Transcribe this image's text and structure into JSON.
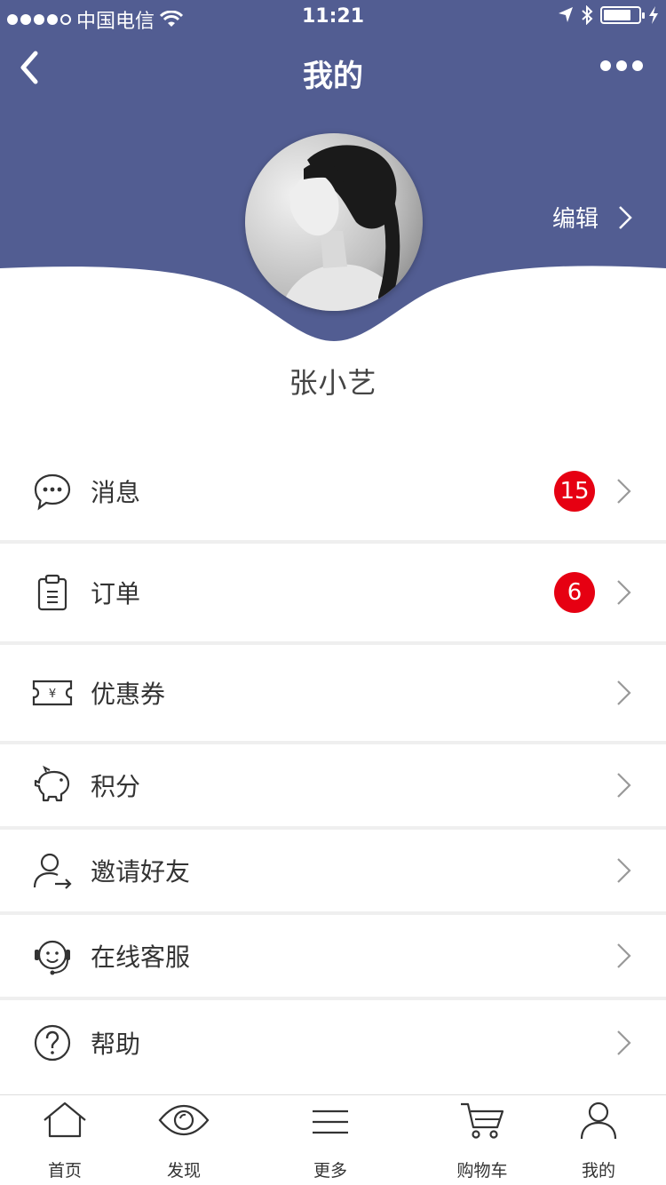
{
  "status_bar": {
    "carrier": "中国电信",
    "time": "11:21"
  },
  "nav": {
    "title": "我的"
  },
  "profile": {
    "edit_label": "编辑",
    "username": "张小艺"
  },
  "menu": [
    {
      "label": "消息",
      "badge": "15",
      "icon": "message-icon"
    },
    {
      "label": "订单",
      "badge": "6",
      "icon": "clipboard-icon"
    },
    {
      "label": "优惠券",
      "badge": "",
      "icon": "coupon-icon"
    },
    {
      "label": "积分",
      "badge": "",
      "icon": "piggy-bank-icon"
    },
    {
      "label": "邀请好友",
      "badge": "",
      "icon": "invite-friend-icon"
    },
    {
      "label": "在线客服",
      "badge": "",
      "icon": "customer-service-icon"
    },
    {
      "label": "帮助",
      "badge": "",
      "icon": "help-icon"
    }
  ],
  "tabbar": [
    {
      "label": "首页",
      "icon": "home-icon"
    },
    {
      "label": "发现",
      "icon": "eye-icon"
    },
    {
      "label": "更多",
      "icon": "menu-lines-icon"
    },
    {
      "label": "购物车",
      "icon": "cart-icon"
    },
    {
      "label": "我的",
      "icon": "user-icon"
    }
  ],
  "colors": {
    "header": "#525d92",
    "badge": "#e60012",
    "divider": "#efefef"
  }
}
